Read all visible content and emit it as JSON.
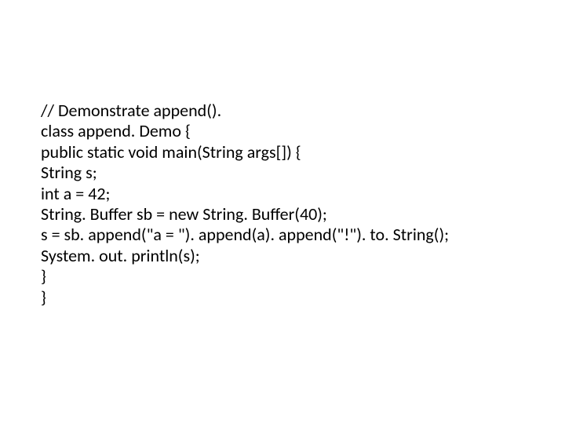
{
  "code": {
    "line1": "// Demonstrate append().",
    "line2": "class append. Demo {",
    "line3": "public static void main(String args[]) {",
    "line4": "String s;",
    "line5": "int a = 42;",
    "line6": "String. Buffer sb = new String. Buffer(40);",
    "line7": "s = sb. append(\"a = \"). append(a). append(\"!\"). to. String();",
    "line8": "System. out. println(s);",
    "line9": "}",
    "line10": "}"
  }
}
